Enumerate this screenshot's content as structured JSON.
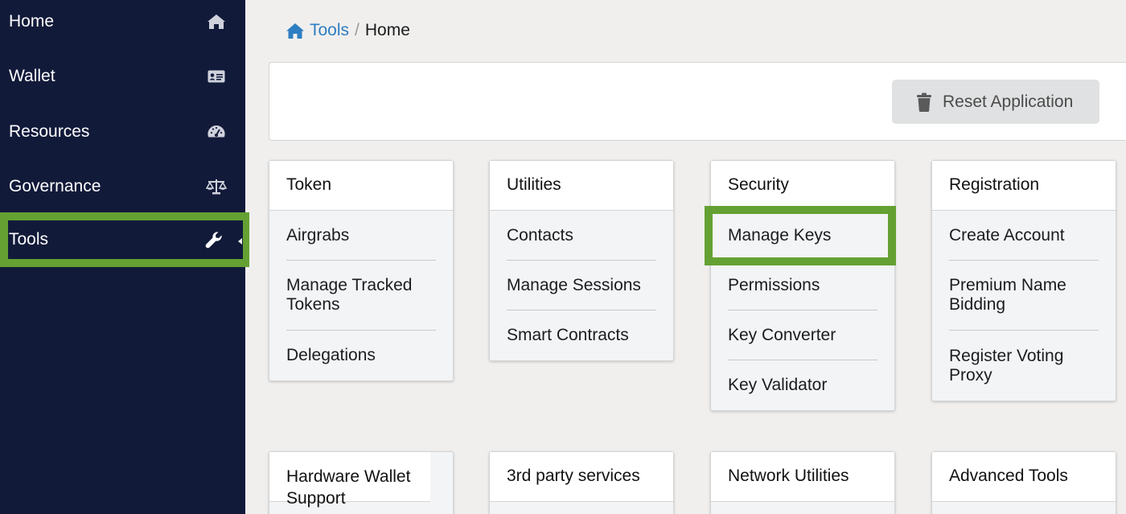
{
  "sidebar": {
    "items": [
      {
        "label": "Home",
        "icon": "home-icon"
      },
      {
        "label": "Wallet",
        "icon": "id-card-icon"
      },
      {
        "label": "Resources",
        "icon": "dashboard-icon"
      },
      {
        "label": "Governance",
        "icon": "balance-scale-icon"
      },
      {
        "label": "Tools",
        "icon": "wrench-icon",
        "active": true
      }
    ]
  },
  "breadcrumb": {
    "link": "Tools",
    "separator": "/",
    "current": "Home"
  },
  "top_panel": {
    "reset_label": "Reset Application"
  },
  "cards": [
    {
      "title": "Token",
      "items": [
        "Airgrabs",
        "Manage Tracked Tokens",
        "Delegations"
      ]
    },
    {
      "title": "Utilities",
      "items": [
        "Contacts",
        "Manage Sessions",
        "Smart Contracts"
      ]
    },
    {
      "title": "Security",
      "items": [
        "Manage Keys",
        "Permissions",
        "Key Converter",
        "Key Validator"
      ]
    },
    {
      "title": "Registration",
      "items": [
        "Create Account",
        "Premium Name Bidding",
        "Register Voting Proxy"
      ]
    },
    {
      "title": "Hardware Wallet Support"
    },
    {
      "title": "3rd party services"
    },
    {
      "title": "Network Utilities"
    },
    {
      "title": "Advanced Tools"
    }
  ],
  "colors": {
    "sidebar_bg": "#121a3a",
    "highlight": "#64a132",
    "link": "#2e7ec2"
  }
}
